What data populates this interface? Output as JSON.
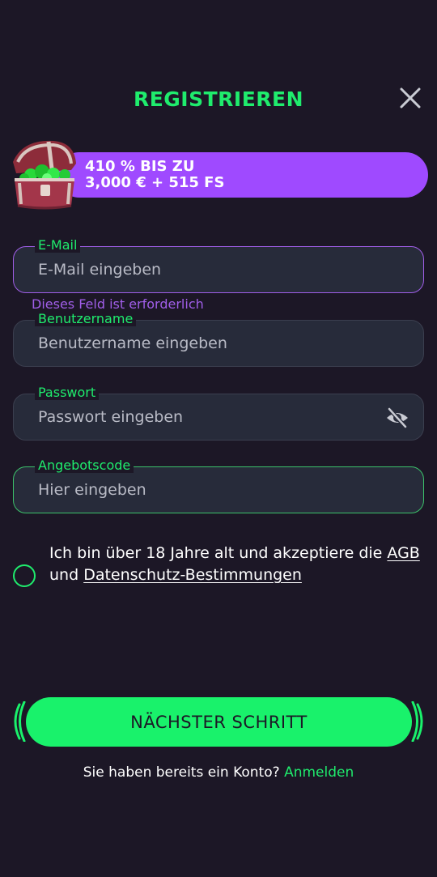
{
  "header": {
    "title": "REGISTRIEREN",
    "close_icon": "close-icon"
  },
  "bonus": {
    "line1": "410 % BIS ZU",
    "line2": "3,000 € + 515 FS",
    "icon": "treasure-chest-icon",
    "color": "#9f4aff"
  },
  "form": {
    "email": {
      "label": "E-Mail",
      "placeholder": "E-Mail eingeben",
      "value": "",
      "error": "Dieses Feld ist erforderlich"
    },
    "username": {
      "label": "Benutzername",
      "placeholder": "Benutzername eingeben",
      "value": ""
    },
    "password": {
      "label": "Passwort",
      "placeholder": "Passwort eingeben",
      "value": "",
      "toggle_icon": "eye-off-icon"
    },
    "promo": {
      "label": "Angebotscode",
      "placeholder": "Hier eingeben",
      "value": ""
    }
  },
  "terms": {
    "text_before": "Ich bin über 18 Jahre alt und akzeptiere die ",
    "agb_link": "AGB ",
    "text_middle": "und ",
    "privacy_link": "Datenschutz-Bestimmungen",
    "checked": false
  },
  "actions": {
    "next_label": "NÄCHSTER SCHRITT",
    "login_prompt": "Sie haben bereits ein Konto?",
    "login_link": "Anmelden"
  },
  "colors": {
    "accent": "#1fec6d",
    "background": "#1c1726",
    "error": "#a05ee8",
    "button": "#19f26b"
  }
}
